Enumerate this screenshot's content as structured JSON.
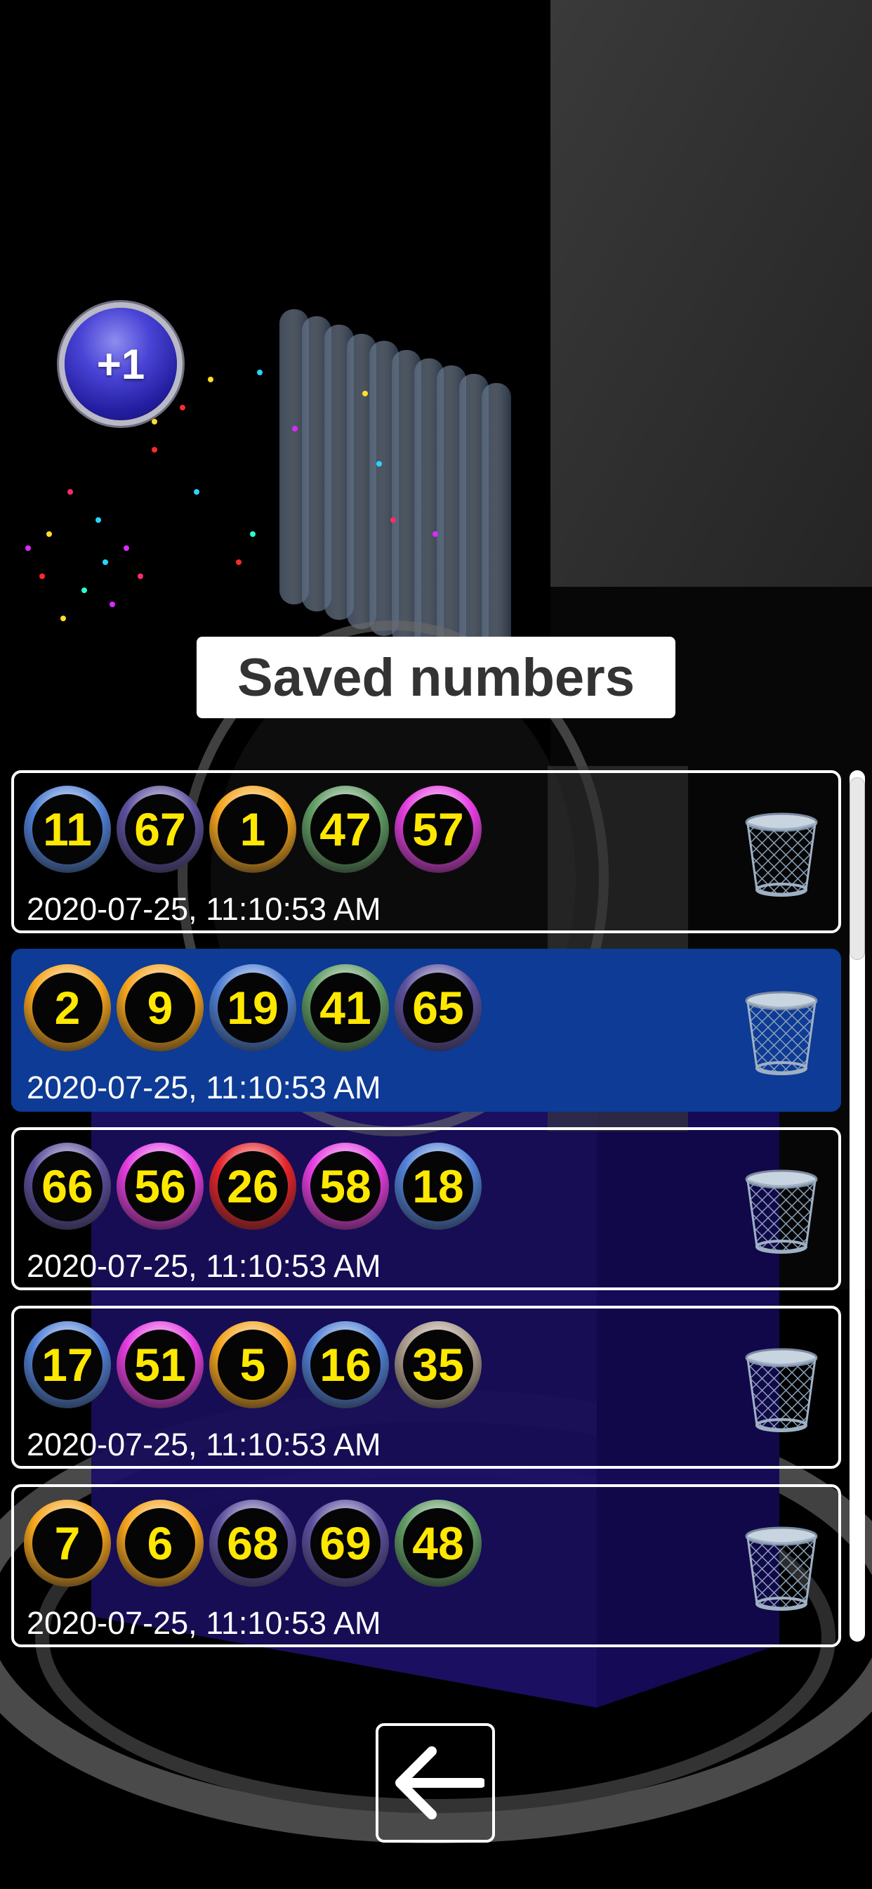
{
  "title": "Saved numbers",
  "plus_button_label": "+1",
  "ball_colors": {
    "blue": "#4f7fd4",
    "purple": "#5b4f9c",
    "orange": "#f5a41c",
    "green": "#5f9a62",
    "magenta": "#e43ce0",
    "red": "#e3232a",
    "beige": "#a89989"
  },
  "saved": [
    {
      "balls": [
        {
          "n": "11",
          "color": "blue"
        },
        {
          "n": "67",
          "color": "purple"
        },
        {
          "n": "1",
          "color": "orange"
        },
        {
          "n": "47",
          "color": "green"
        },
        {
          "n": "57",
          "color": "magenta"
        }
      ],
      "date": "2020-07-25, 11:10:53 AM",
      "selected": false
    },
    {
      "balls": [
        {
          "n": "2",
          "color": "orange"
        },
        {
          "n": "9",
          "color": "orange"
        },
        {
          "n": "19",
          "color": "blue"
        },
        {
          "n": "41",
          "color": "green"
        },
        {
          "n": "65",
          "color": "purple"
        }
      ],
      "date": "2020-07-25, 11:10:53 AM",
      "selected": true
    },
    {
      "balls": [
        {
          "n": "66",
          "color": "purple"
        },
        {
          "n": "56",
          "color": "magenta"
        },
        {
          "n": "26",
          "color": "red"
        },
        {
          "n": "58",
          "color": "magenta"
        },
        {
          "n": "18",
          "color": "blue"
        }
      ],
      "date": "2020-07-25, 11:10:53 AM",
      "selected": false
    },
    {
      "balls": [
        {
          "n": "17",
          "color": "blue"
        },
        {
          "n": "51",
          "color": "magenta"
        },
        {
          "n": "5",
          "color": "orange"
        },
        {
          "n": "16",
          "color": "blue"
        },
        {
          "n": "35",
          "color": "beige"
        }
      ],
      "date": "2020-07-25, 11:10:53 AM",
      "selected": false
    },
    {
      "balls": [
        {
          "n": "7",
          "color": "orange"
        },
        {
          "n": "6",
          "color": "orange"
        },
        {
          "n": "68",
          "color": "purple"
        },
        {
          "n": "69",
          "color": "purple"
        },
        {
          "n": "48",
          "color": "green"
        }
      ],
      "date": "2020-07-25, 11:10:53 AM",
      "selected": false
    }
  ],
  "icons": {
    "delete": "trash-icon",
    "back": "arrow-left-icon"
  }
}
